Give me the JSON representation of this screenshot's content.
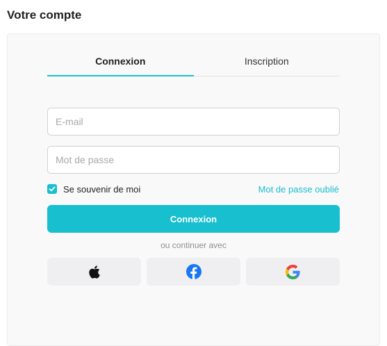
{
  "page": {
    "title": "Votre compte"
  },
  "tabs": [
    {
      "label": "Connexion",
      "active": true
    },
    {
      "label": "Inscription",
      "active": false
    }
  ],
  "form": {
    "email_placeholder": "E-mail",
    "email_value": "",
    "password_placeholder": "Mot de passe",
    "password_value": "",
    "remember_label": "Se souvenir de moi",
    "remember_checked": true,
    "forgot_label": "Mot de passe oublié",
    "submit_label": "Connexion"
  },
  "social": {
    "separator": "ou continuer avec",
    "providers": [
      {
        "icon": "apple-icon"
      },
      {
        "icon": "facebook-icon"
      },
      {
        "icon": "google-icon"
      }
    ]
  },
  "colors": {
    "accent": "#18bfcf",
    "card_background": "#f9f9f9",
    "social_button_background": "#efeff1",
    "facebook": "#1877f2"
  }
}
